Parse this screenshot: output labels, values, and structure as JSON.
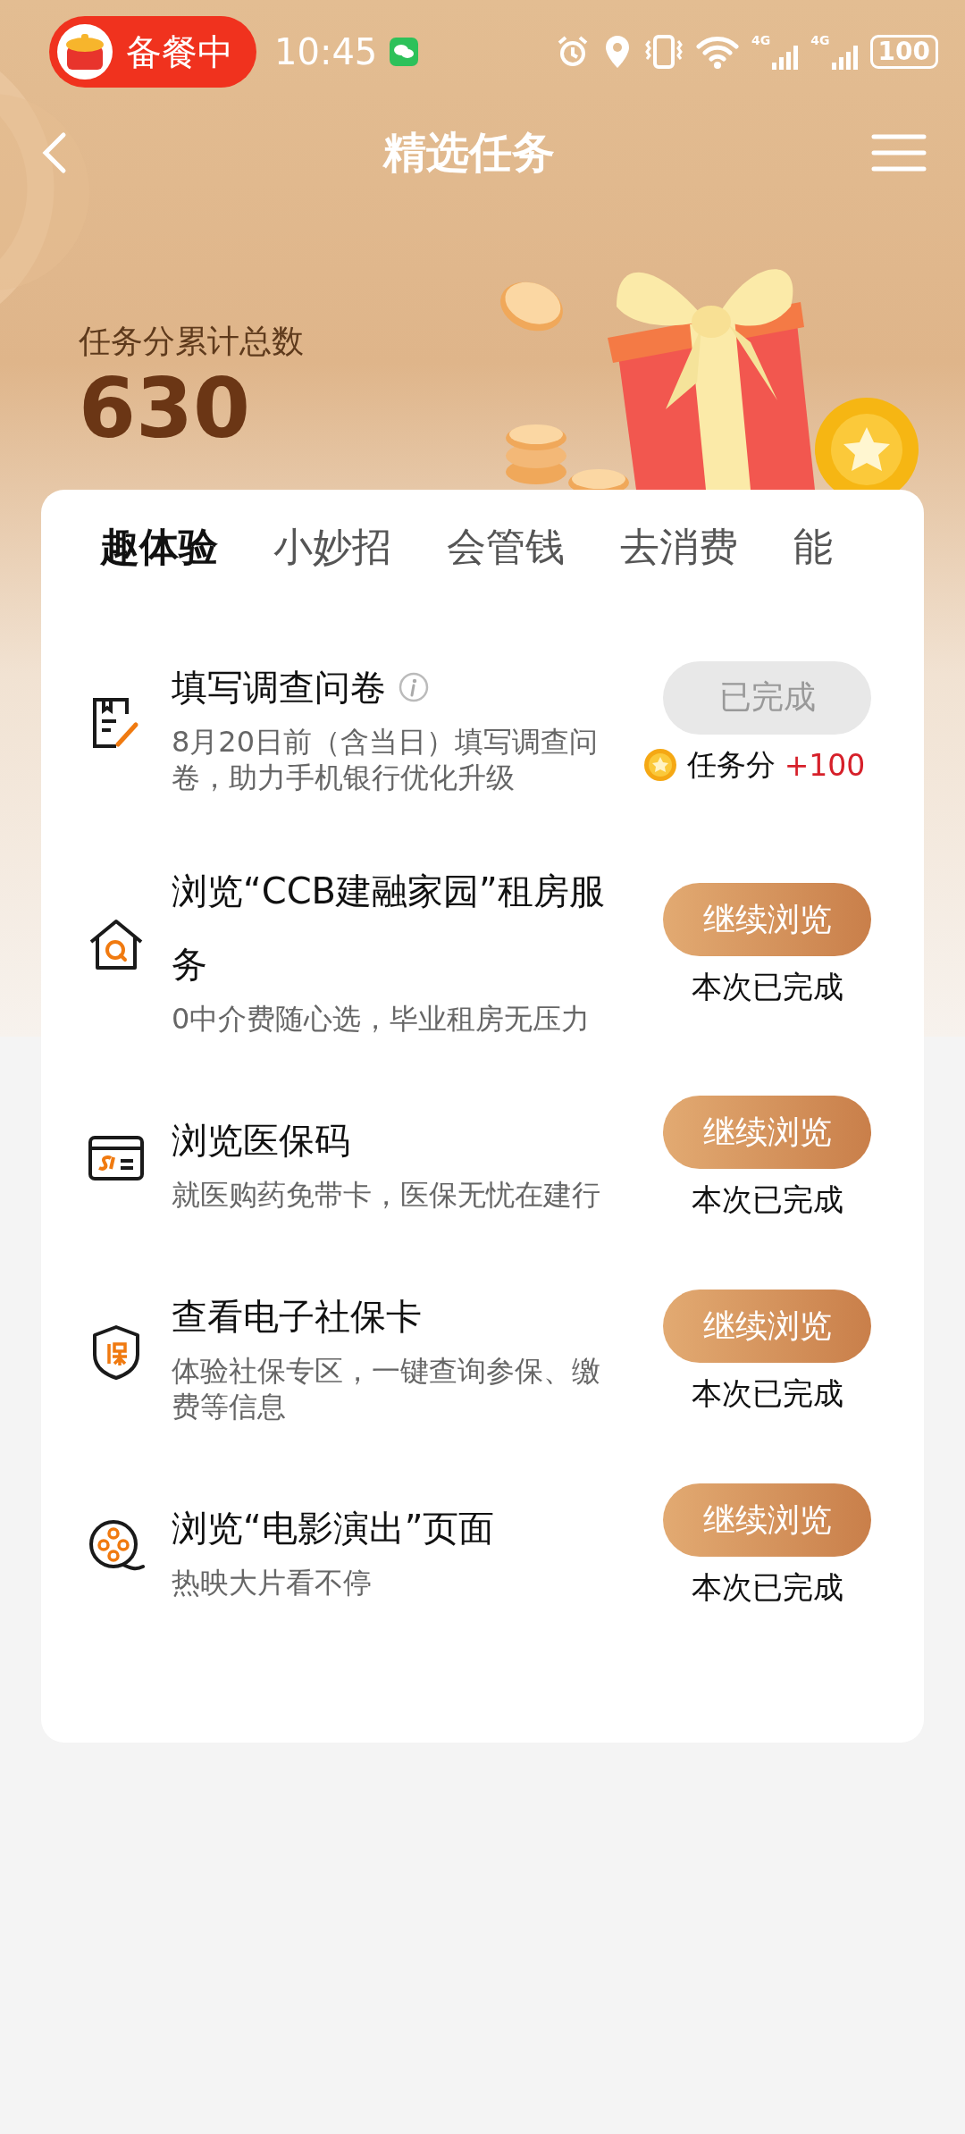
{
  "status_bar": {
    "badge": "备餐中",
    "time": "10:45",
    "signals": [
      {
        "label": "4G"
      },
      {
        "label": "4G"
      }
    ],
    "battery": "100"
  },
  "header": {
    "title": "精选任务"
  },
  "summary": {
    "label": "任务分累计总数",
    "total": "630"
  },
  "tabs": [
    {
      "label": "趣体验",
      "selected": true
    },
    {
      "label": "小妙招",
      "selected": false
    },
    {
      "label": "会管钱",
      "selected": false
    },
    {
      "label": "去消费",
      "selected": false
    },
    {
      "label": "能",
      "selected": false
    }
  ],
  "tasks": [
    {
      "title": "填写调查问卷",
      "info": true,
      "description": "8月20日前（含当日）填写调查问卷，助力手机银行优化升级",
      "button": {
        "label": "已完成",
        "disabled": true
      },
      "kind": "reward",
      "reward_label": "任务分",
      "reward_points": "+100"
    },
    {
      "title": "浏览“CCB建融家园”租房服务",
      "info": false,
      "description": "0中介费随心选，毕业租房无压力",
      "button": {
        "label": "继续浏览",
        "disabled": false
      },
      "kind": "note",
      "note": "本次已完成"
    },
    {
      "title": "浏览医保码",
      "info": false,
      "description": "就医购药免带卡，医保无忧在建行",
      "button": {
        "label": "继续浏览",
        "disabled": false
      },
      "kind": "note",
      "note": "本次已完成"
    },
    {
      "title": "查看电子社保卡",
      "info": false,
      "description": "体验社保专区，一键查询参保、缴费等信息",
      "button": {
        "label": "继续浏览",
        "disabled": false
      },
      "kind": "note",
      "note": "本次已完成"
    },
    {
      "title": "浏览“电影演出”页面",
      "info": false,
      "description": "热映大片看不停",
      "button": {
        "label": "继续浏览",
        "disabled": false
      },
      "kind": "note",
      "note": "本次已完成"
    }
  ]
}
